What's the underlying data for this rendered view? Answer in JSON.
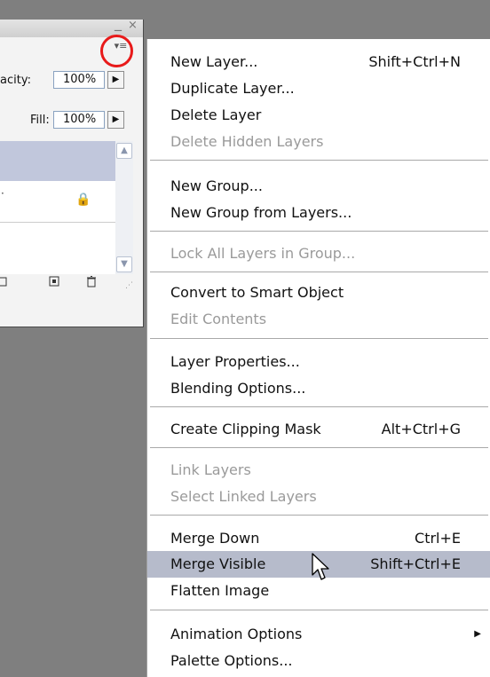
{
  "panel": {
    "window_controls": {
      "minimize": "_",
      "close": "×"
    },
    "menu_button": "▾≡",
    "opacity_label": "acity:",
    "opacity_value": "100%",
    "fill_label": "Fill:",
    "fill_value": "100%",
    "arrow": "▶",
    "lock": "🔒",
    "icons": [
      "new-group-icon",
      "new-layer-icon",
      "trash-icon"
    ]
  },
  "menu": {
    "items": [
      {
        "label": "New Layer...",
        "shortcut": "Shift+Ctrl+N",
        "enabled": true
      },
      {
        "label": "Duplicate Layer...",
        "shortcut": "",
        "enabled": true
      },
      {
        "label": "Delete Layer",
        "shortcut": "",
        "enabled": true
      },
      {
        "label": "Delete Hidden Layers",
        "shortcut": "",
        "enabled": false
      },
      {
        "label": "New Group...",
        "shortcut": "",
        "enabled": true
      },
      {
        "label": "New Group from Layers...",
        "shortcut": "",
        "enabled": true
      },
      {
        "label": "Lock All Layers in Group...",
        "shortcut": "",
        "enabled": false
      },
      {
        "label": "Convert to Smart Object",
        "shortcut": "",
        "enabled": true
      },
      {
        "label": "Edit Contents",
        "shortcut": "",
        "enabled": false
      },
      {
        "label": "Layer Properties...",
        "shortcut": "",
        "enabled": true
      },
      {
        "label": "Blending Options...",
        "shortcut": "",
        "enabled": true
      },
      {
        "label": "Create Clipping Mask",
        "shortcut": "Alt+Ctrl+G",
        "enabled": true
      },
      {
        "label": "Link Layers",
        "shortcut": "",
        "enabled": false
      },
      {
        "label": "Select Linked Layers",
        "shortcut": "",
        "enabled": false
      },
      {
        "label": "Merge Down",
        "shortcut": "Ctrl+E",
        "enabled": true
      },
      {
        "label": "Merge Visible",
        "shortcut": "Shift+Ctrl+E",
        "enabled": true,
        "highlighted": true
      },
      {
        "label": "Flatten Image",
        "shortcut": "",
        "enabled": true
      },
      {
        "label": "Animation Options",
        "shortcut": "",
        "enabled": true,
        "submenu": true
      },
      {
        "label": "Palette Options...",
        "shortcut": "",
        "enabled": true
      }
    ],
    "submenu_arrow": "▶"
  },
  "colors": {
    "highlight_circle": "#e81a1a",
    "menu_hover": "#b6bbcb",
    "selected_layer": "#c1c7dc",
    "disabled_text": "#9a9a9a"
  }
}
